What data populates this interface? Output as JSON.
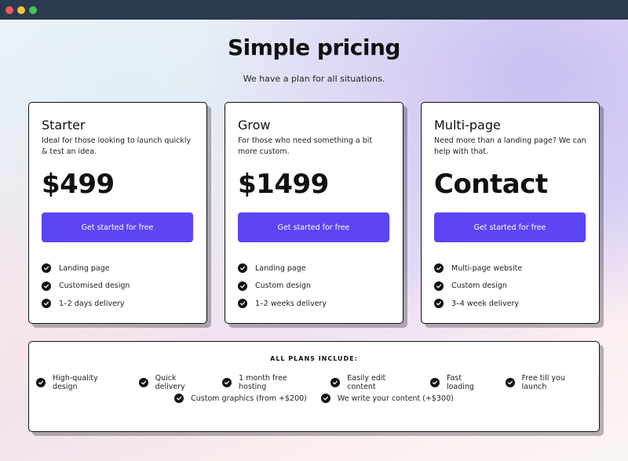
{
  "window": {
    "controls": [
      "close",
      "minimize",
      "maximize"
    ]
  },
  "header": {
    "title": "Simple pricing",
    "subtitle": "We have a plan for all situations."
  },
  "plans": [
    {
      "name": "Starter",
      "description": "Ideal for those looking to launch quickly & test an idea.",
      "price": "$499",
      "cta_label": "Get started for free",
      "features": [
        "Landing page",
        "Customised design",
        "1–2 days delivery"
      ]
    },
    {
      "name": "Grow",
      "description": "For those who need something a bit more custom.",
      "price": "$1499",
      "cta_label": "Get started for free",
      "features": [
        "Landing page",
        "Custom design",
        "1–2 weeks delivery"
      ]
    },
    {
      "name": "Multi-page",
      "description": "Need more than a landing page? We can help with that.",
      "price": "Contact",
      "cta_label": "Get started for free",
      "features": [
        "Multi-page website",
        "Custom design",
        "3–4 week delivery"
      ]
    }
  ],
  "includes": {
    "title": "ALL PLANS INCLUDE:",
    "row1": [
      "High-quality design",
      "Quick delivery",
      "1 month free hosting",
      "Easily edit content",
      "Fast loading",
      "Free till you launch"
    ],
    "row2": [
      "Custom graphics (from +$200)",
      "We write your content (+$300)"
    ]
  },
  "colors": {
    "accent": "#5b45f5",
    "titlebar": "#2b3a4f",
    "close": "#f05b5b",
    "minimize": "#f5c33e",
    "maximize": "#42c556"
  },
  "icons": {
    "feature_check": "check-circle-icon"
  }
}
